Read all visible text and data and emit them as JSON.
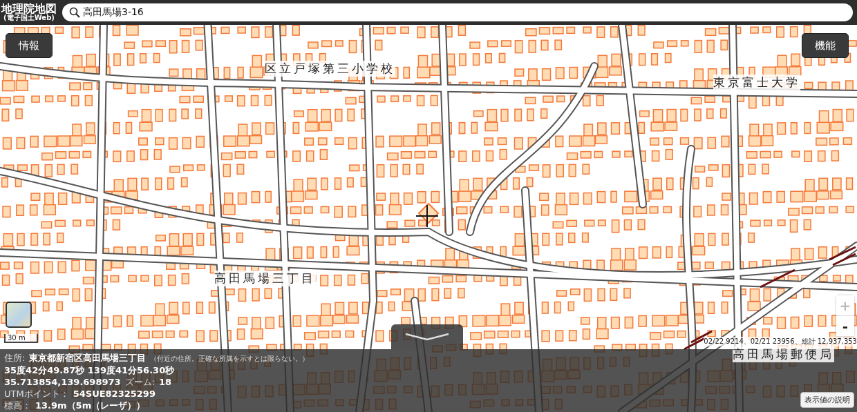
{
  "header": {
    "logo_title": "地理院地図",
    "logo_subtitle": "(電子国土Web)",
    "search": {
      "value": "高田馬場3-16"
    }
  },
  "buttons": {
    "info": "情報",
    "functions": "機能"
  },
  "map_labels": [
    {
      "text": "区立戸塚第三小学校"
    },
    {
      "text": "東京富士大学"
    },
    {
      "text": "高田馬場三丁目"
    },
    {
      "text": "高田馬場郵便局"
    }
  ],
  "zoom_controls": [
    {
      "label": "+",
      "disabled": true
    },
    {
      "label": "-",
      "disabled": false
    }
  ],
  "scale": "30 m",
  "counter": "02/22 9214、02/21 23956、総計 12,937,353",
  "info_panel": {
    "address_label": "住所:",
    "address": "東京都新宿区高田馬場三丁目",
    "address_note": "（付近の住所。正確な所属を示すとは限らない。）",
    "dms": "35度42分49.87秒 139度41分56.30秒",
    "decimal": "35.713854,139.698973",
    "zoom_label": "ズーム:",
    "zoom": "18",
    "utm_label": "UTMポイント：",
    "utm": "54SUE82325299",
    "elevation_label": "標高：",
    "elevation": "13.9m（5m（レーザ））",
    "help_button": "表示値の説明"
  }
}
